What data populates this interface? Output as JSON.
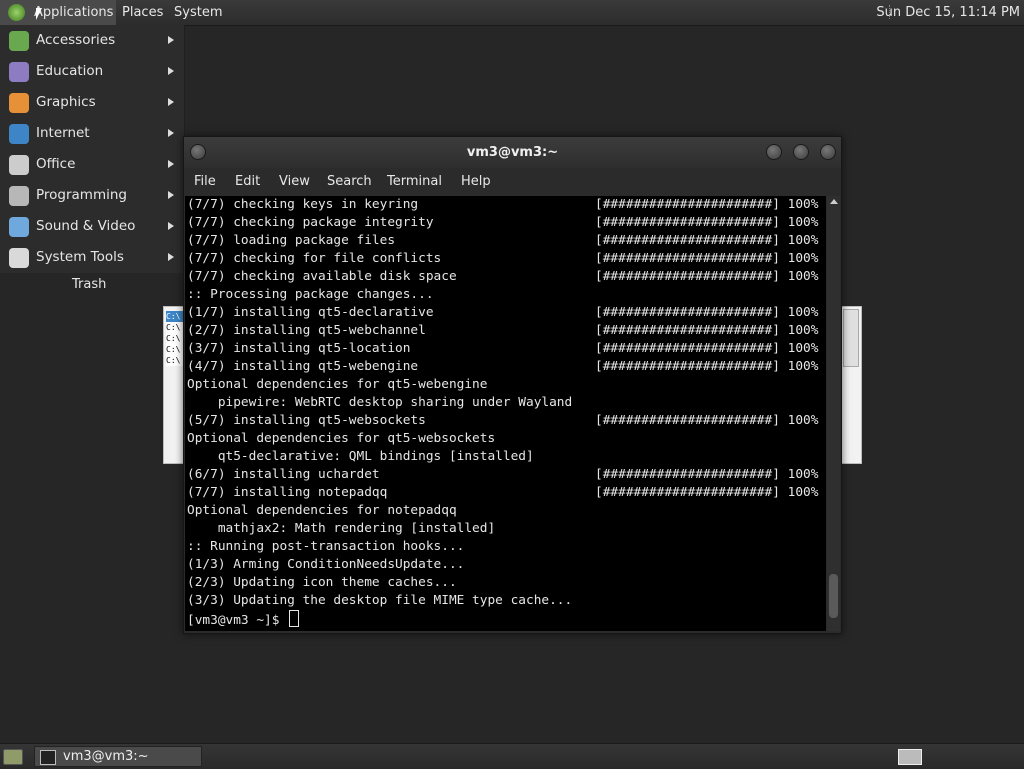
{
  "top_panel": {
    "menus": [
      "Applications",
      "Places",
      "System"
    ],
    "clock": "Sun Dec 15, 11:14 PM"
  },
  "apps_menu": {
    "items": [
      {
        "label": "Accessories",
        "icon": "accessories-icon",
        "color": "#6aa84f"
      },
      {
        "label": "Education",
        "icon": "education-icon",
        "color": "#8e7cc3"
      },
      {
        "label": "Graphics",
        "icon": "graphics-icon",
        "color": "#e69138"
      },
      {
        "label": "Internet",
        "icon": "internet-icon",
        "color": "#3d85c6"
      },
      {
        "label": "Office",
        "icon": "office-icon",
        "color": "#cccccc"
      },
      {
        "label": "Programming",
        "icon": "programming-icon",
        "color": "#b7b7b7"
      },
      {
        "label": "Sound & Video",
        "icon": "sound-video-icon",
        "color": "#6fa8dc"
      },
      {
        "label": "System Tools",
        "icon": "system-tools-icon",
        "color": "#d9d9d9"
      }
    ]
  },
  "desktop": {
    "trash_label": "Trash"
  },
  "bg_window": {
    "lines": [
      "C:\\",
      "C:\\",
      "C:\\",
      "C:\\",
      "C:\\"
    ]
  },
  "terminal": {
    "title": "vm3@vm3:~",
    "menus": [
      "File",
      "Edit",
      "View",
      "Search",
      "Terminal",
      "Help"
    ],
    "lines": [
      {
        "text": "(7/7) checking keys in keyring",
        "progress": "[######################] 100%"
      },
      {
        "text": "(7/7) checking package integrity",
        "progress": "[######################] 100%"
      },
      {
        "text": "(7/7) loading package files",
        "progress": "[######################] 100%"
      },
      {
        "text": "(7/7) checking for file conflicts",
        "progress": "[######################] 100%"
      },
      {
        "text": "(7/7) checking available disk space",
        "progress": "[######################] 100%"
      },
      {
        "text": ":: Processing package changes...",
        "progress": ""
      },
      {
        "text": "(1/7) installing qt5-declarative",
        "progress": "[######################] 100%"
      },
      {
        "text": "(2/7) installing qt5-webchannel",
        "progress": "[######################] 100%"
      },
      {
        "text": "(3/7) installing qt5-location",
        "progress": "[######################] 100%"
      },
      {
        "text": "(4/7) installing qt5-webengine",
        "progress": "[######################] 100%"
      },
      {
        "text": "Optional dependencies for qt5-webengine",
        "progress": ""
      },
      {
        "text": "    pipewire: WebRTC desktop sharing under Wayland",
        "progress": ""
      },
      {
        "text": "(5/7) installing qt5-websockets",
        "progress": "[######################] 100%"
      },
      {
        "text": "Optional dependencies for qt5-websockets",
        "progress": ""
      },
      {
        "text": "    qt5-declarative: QML bindings [installed]",
        "progress": ""
      },
      {
        "text": "(6/7) installing uchardet",
        "progress": "[######################] 100%"
      },
      {
        "text": "(7/7) installing notepadqq",
        "progress": "[######################] 100%"
      },
      {
        "text": "Optional dependencies for notepadqq",
        "progress": ""
      },
      {
        "text": "    mathjax2: Math rendering [installed]",
        "progress": ""
      },
      {
        "text": ":: Running post-transaction hooks...",
        "progress": ""
      },
      {
        "text": "(1/3) Arming ConditionNeedsUpdate...",
        "progress": ""
      },
      {
        "text": "(2/3) Updating icon theme caches...",
        "progress": ""
      },
      {
        "text": "(3/3) Updating the desktop file MIME type cache...",
        "progress": ""
      }
    ],
    "prompt": "[vm3@vm3 ~]$ "
  },
  "taskbar": {
    "task_label": "vm3@vm3:~"
  }
}
